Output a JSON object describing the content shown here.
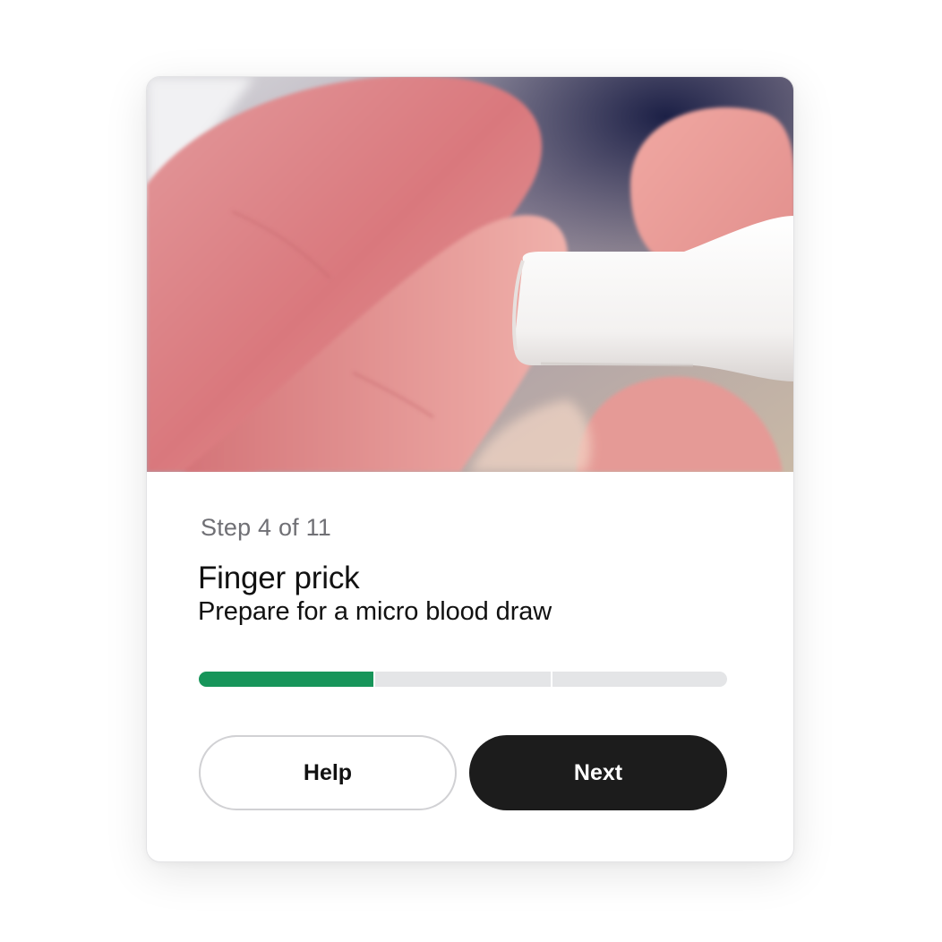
{
  "card": {
    "step_label": "Step 4 of 11",
    "title": "Finger prick",
    "subtitle": "Prepare for a micro blood draw"
  },
  "progress": {
    "segments": 3,
    "completed_segments": 1,
    "accent_color": "#17955a",
    "track_color": "#e4e5e7"
  },
  "buttons": {
    "help_label": "Help",
    "next_label": "Next"
  },
  "image": {
    "subject": "fingers-with-lancet-photo"
  }
}
